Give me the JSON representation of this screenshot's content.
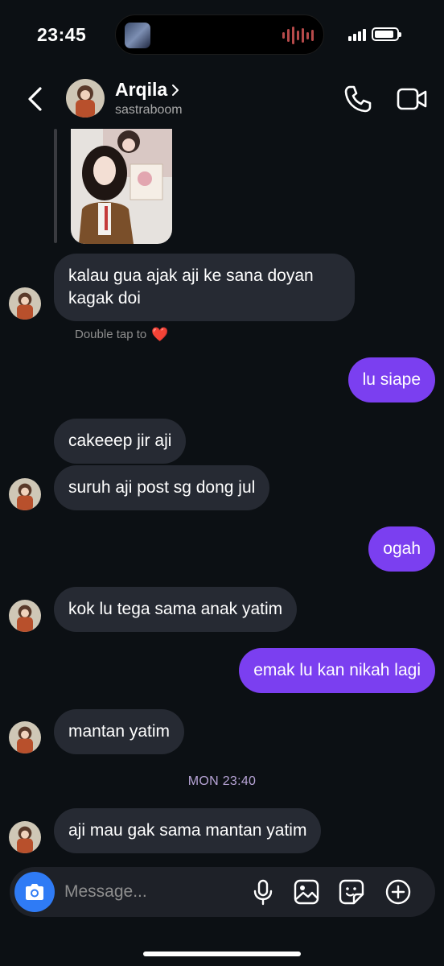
{
  "status_bar": {
    "time": "23:45",
    "battery_percent": 88
  },
  "header": {
    "contact_name": "Arqila",
    "handle": "sastraboom",
    "icons": [
      "back-icon",
      "chevron-right-icon",
      "phone-icon",
      "video-icon"
    ]
  },
  "conversation": {
    "messages": [
      {
        "sender": "them",
        "text": "kalau gua ajak aji ke sana doyan",
        "text2": "kagak doi"
      },
      {
        "sender": "me",
        "text": "lu siape"
      },
      {
        "sender": "them",
        "text": "cakeeep jir aji"
      },
      {
        "sender": "them",
        "text": "suruh aji post sg dong jul"
      },
      {
        "sender": "me",
        "text": "ogah"
      },
      {
        "sender": "them",
        "text": "kok lu tega sama anak yatim"
      },
      {
        "sender": "me",
        "text": "emak lu kan nikah lagi"
      },
      {
        "sender": "them",
        "text": "mantan yatim"
      },
      {
        "sender": "them",
        "text": "aji mau gak sama mantan yatim"
      }
    ],
    "double_tap_hint": "Double tap to",
    "double_tap_emoji": "❤️",
    "timestamp": "MON 23:40"
  },
  "composer": {
    "placeholder": "Message...",
    "icons": [
      "camera-icon",
      "microphone-icon",
      "gallery-icon",
      "sticker-icon",
      "plus-icon"
    ]
  },
  "colors": {
    "background": "#0c1014",
    "incoming_bubble": "#262a33",
    "outgoing_bubble": "#7b3ff0",
    "camera_button": "#2f7bf5"
  }
}
